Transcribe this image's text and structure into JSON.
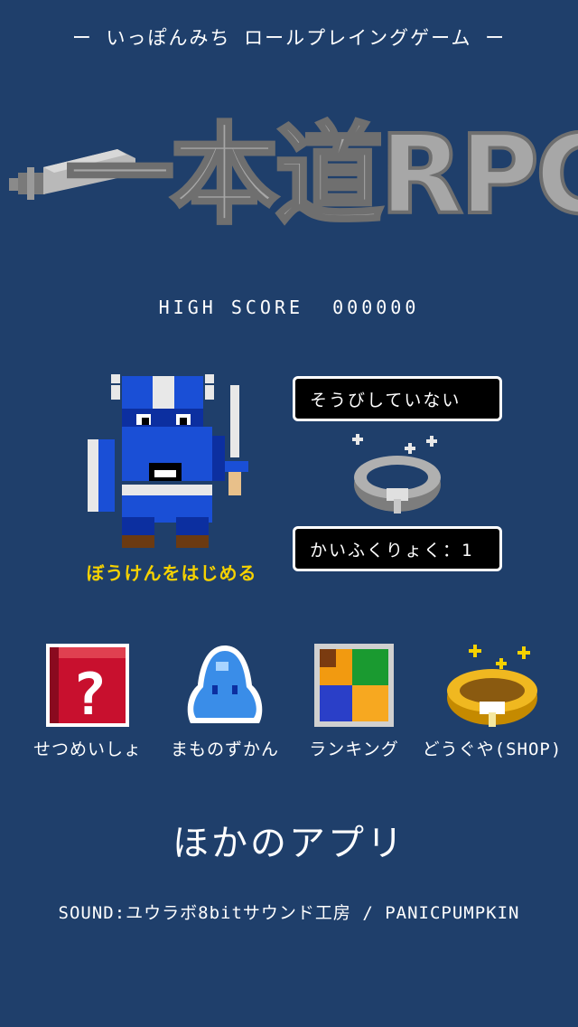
{
  "header": {
    "subtitle": "ー いっぽんみち ロールプレイングゲーム ー",
    "logo_text": "一本道RPG"
  },
  "score": {
    "label": "HIGH SCORE",
    "value": "000000"
  },
  "hero": {
    "start_label": "ぼうけんをはじめる"
  },
  "equipment": {
    "status": "そうびしていない",
    "recovery": "かいふくりょく：1"
  },
  "menu": [
    {
      "label": "せつめいしょ",
      "icon": "manual-book-icon"
    },
    {
      "label": "まものずかん",
      "icon": "slime-icon"
    },
    {
      "label": "ランキング",
      "icon": "ranking-icon"
    },
    {
      "label": "どうぐや(SHOP)",
      "icon": "gold-ring-icon"
    }
  ],
  "other_apps": "ほかのアプリ",
  "credits": "SOUND:ユウラボ8bitサウンド工房 / PANICPUMPKIN",
  "colors": {
    "background": "#1f3f6b",
    "accent_yellow": "#f5d100",
    "logo_gray": "#a7a7a7"
  }
}
